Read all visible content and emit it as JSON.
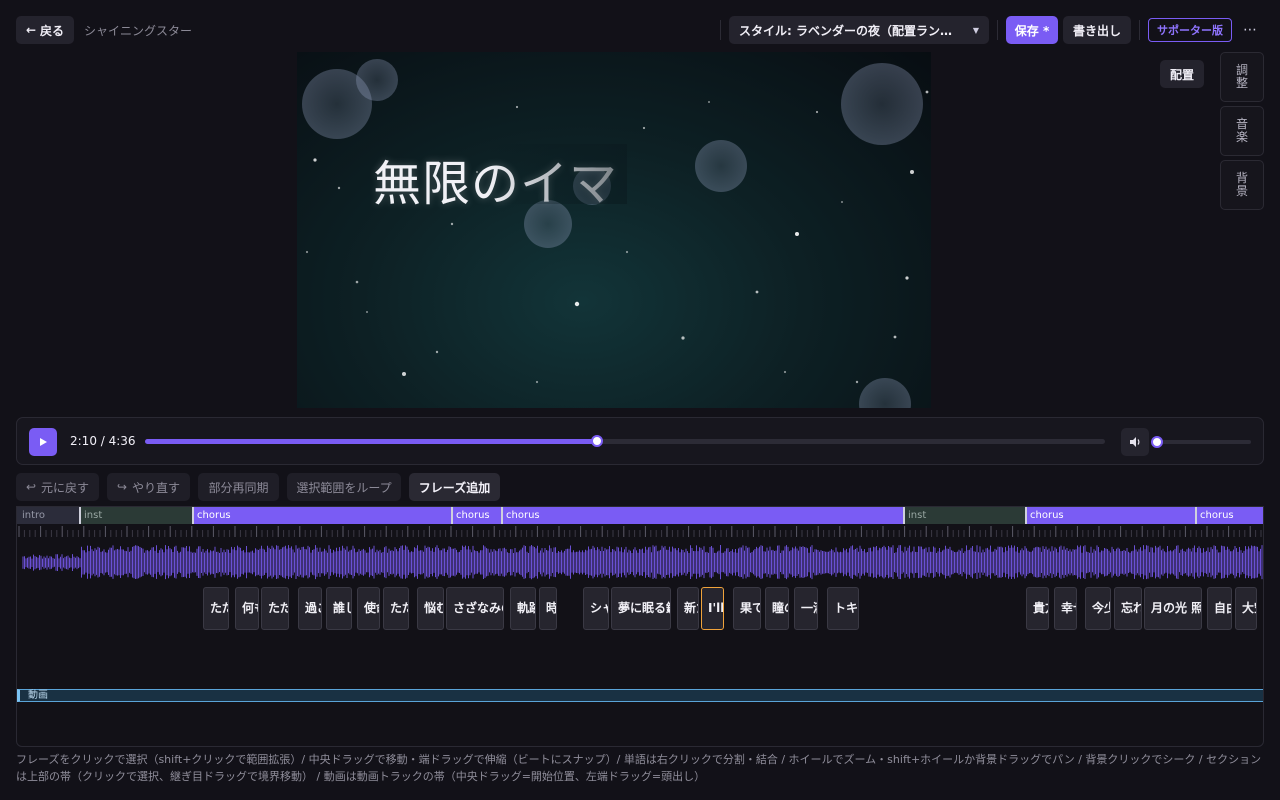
{
  "header": {
    "back_label": "戻る",
    "project_title": "シャイニングスター",
    "style_label": "スタイル: ラベンダーの夜（配置ランダム）",
    "save_label": "保存 *",
    "export_label": "書き出し",
    "supporter_label": "サポーター版",
    "more_label": "⋯"
  },
  "preview": {
    "lyric_text": "無限のイマ"
  },
  "side_panel": {
    "layout_label": "配置",
    "tabs": [
      "調整",
      "音楽",
      "背景"
    ]
  },
  "player": {
    "time": "2:10 / 4:36",
    "progress": 0.471,
    "volume": 0.0
  },
  "toolbar": {
    "undo_label": "元に戻す",
    "redo_label": "やり直す",
    "resync_label": "部分再同期",
    "loop_label": "選択範囲をループ",
    "add_phrase_label": "フレーズ追加"
  },
  "timeline": {
    "sections": [
      {
        "name": "intro",
        "kind": "intro"
      },
      {
        "name": "inst",
        "kind": "inst"
      },
      {
        "name": "chorus",
        "kind": "chorus"
      },
      {
        "name": "chorus",
        "kind": "chorus"
      },
      {
        "name": "chorus",
        "kind": "chorus"
      },
      {
        "name": "inst",
        "kind": "inst"
      },
      {
        "name": "chorus",
        "kind": "chorus"
      },
      {
        "name": "chorus",
        "kind": "chorus"
      }
    ],
    "phrases": [
      "ただ",
      "何も",
      "ただ",
      "過ご",
      "誰し",
      "使命",
      "ただ",
      "悩む",
      "さざなみの",
      "軌跡",
      "時",
      "シャ",
      "夢に眠る鍵",
      "新た",
      "I'll",
      "果て",
      "瞳の",
      "一滴",
      "トキ",
      "貴方",
      "幸せ",
      "今少",
      "忘れ",
      "月の光 照",
      "自由",
      "大空"
    ],
    "selected_phrase": "I'll",
    "video_track_label": "動画"
  },
  "help_text": "フレーズをクリックで選択（shift+クリックで範囲拡張）/ 中央ドラッグで移動・端ドラッグで伸縮（ビートにスナップ）/ 単語は右クリックで分割・結合 / ホイールでズーム・shift+ホイールか背景ドラッグでパン / 背景クリックでシーク / セクションは上部の帯（クリックで選択、継ぎ目ドラッグで境界移動） / 動画は動画トラックの帯（中央ドラッグ=開始位置、左端ドラッグ=頭出し）",
  "colors": {
    "accent": "#7a5cf4",
    "selected_outline": "#f0a33b",
    "video_track": "#5aa4d8"
  }
}
